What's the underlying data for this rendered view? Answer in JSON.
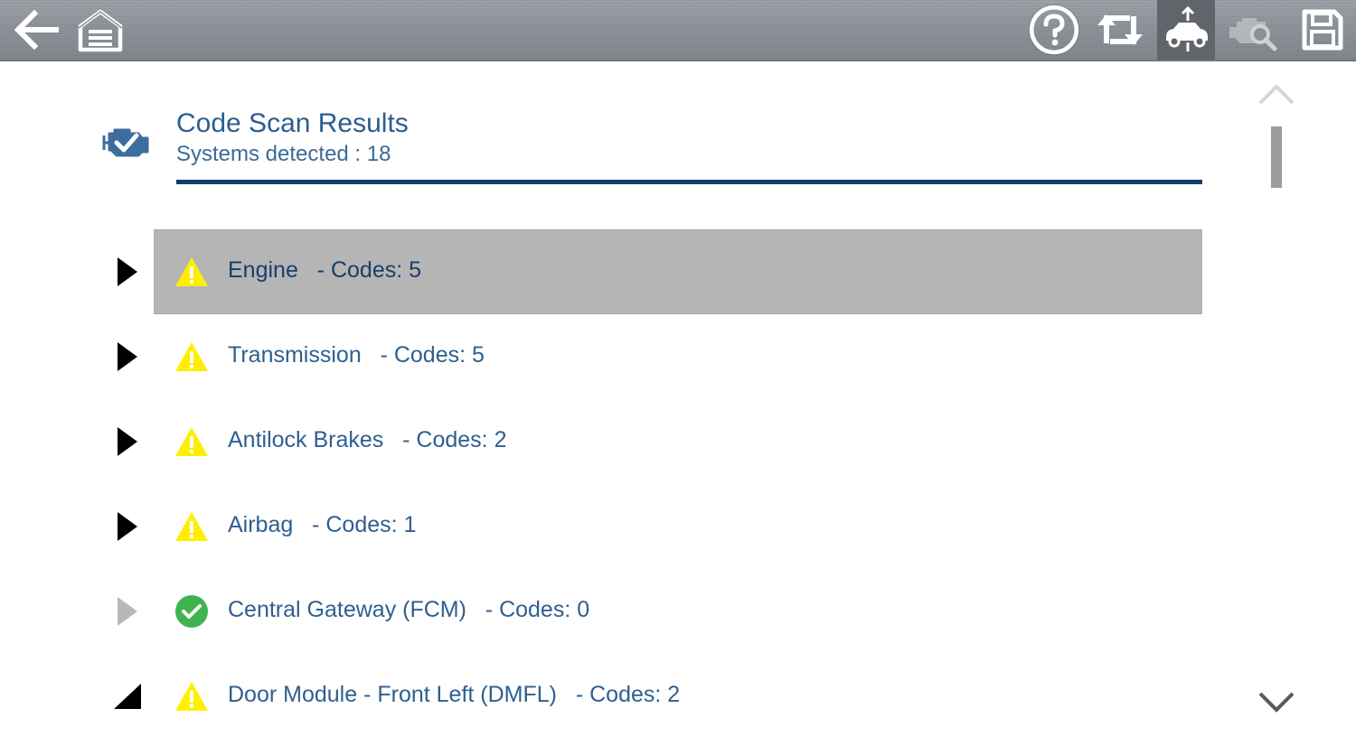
{
  "toolbar": {
    "buttons": [
      {
        "icon": "back-arrow-icon"
      },
      {
        "icon": "garage-home-icon"
      },
      {
        "icon": "help-icon"
      },
      {
        "icon": "refresh-swap-icon"
      },
      {
        "icon": "vehicle-connect-icon",
        "active": true
      },
      {
        "icon": "vehicle-search-icon",
        "disabled": true
      },
      {
        "icon": "save-icon"
      }
    ]
  },
  "header": {
    "icon": "engine-check-icon",
    "title": "Code Scan Results",
    "subtitle": "Systems detected : 18"
  },
  "colors": {
    "accent": "#143d6b",
    "text_blue": "#2f5f90",
    "warning_yellow": "#ffee00",
    "ok_green": "#3fb34f",
    "selected_bg": "#b5b5b5"
  },
  "systems": [
    {
      "name": "Engine",
      "codes": "- Codes: 5",
      "status": "warning-icon",
      "expander": "expand-arrow-icon",
      "selected": true
    },
    {
      "name": "Transmission",
      "codes": "- Codes: 5",
      "status": "warning-icon",
      "expander": "expand-arrow-icon"
    },
    {
      "name": "Antilock Brakes",
      "codes": "- Codes: 2",
      "status": "warning-icon",
      "expander": "expand-arrow-icon"
    },
    {
      "name": "Airbag",
      "codes": "- Codes: 1",
      "status": "warning-icon",
      "expander": "expand-arrow-icon"
    },
    {
      "name": "Central Gateway (FCM)",
      "codes": "- Codes: 0",
      "status": "check-ok-icon",
      "expander": "expand-arrow-disabled-icon"
    },
    {
      "name": "Door Module - Front Left (DMFL)",
      "codes": "- Codes: 2",
      "status": "warning-icon",
      "expander": "expanded-arrow-icon"
    }
  ]
}
